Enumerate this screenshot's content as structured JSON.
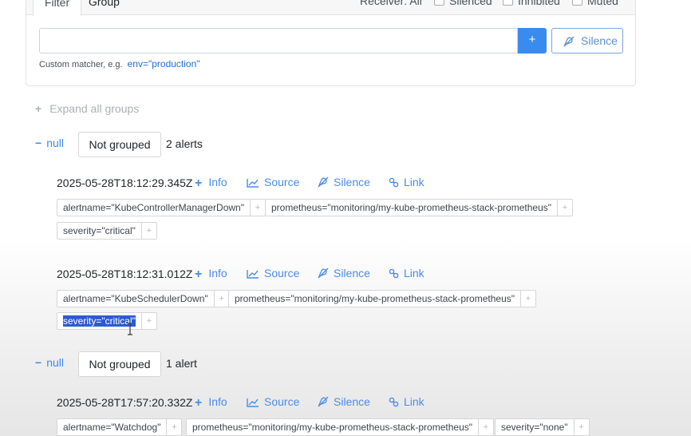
{
  "filter_card": {
    "tabs": [
      {
        "label": "Filter"
      },
      {
        "label": "Group"
      }
    ],
    "receiver_text": "Receiver: All",
    "checkboxes": [
      {
        "label": "Silenced"
      },
      {
        "label": "Inhibited"
      },
      {
        "label": "Muted"
      }
    ],
    "input_value": "",
    "plus_label": "+",
    "silence_label": "Silence",
    "hint_text": "Custom matcher, e.g.",
    "hint_example": "env=\"production\""
  },
  "expand_all": {
    "icon": "+",
    "label": "Expand all groups"
  },
  "groups": [
    {
      "collapse_icon": "−",
      "name": "null",
      "badge": "Not grouped",
      "count": "2 alerts",
      "alerts": [
        {
          "timestamp": "2025-05-28T18:12:29.345Z",
          "actions": [
            "Info",
            "Source",
            "Silence",
            "Link"
          ],
          "labels": [
            "alertname=\"KubeControllerManagerDown\"",
            "prometheus=\"monitoring/my-kube-prometheus-stack-prometheus\"",
            "severity=\"critical\""
          ]
        },
        {
          "timestamp": "2025-05-28T18:12:31.012Z",
          "actions": [
            "Info",
            "Source",
            "Silence",
            "Link"
          ],
          "labels": [
            "alertname=\"KubeSchedulerDown\"",
            "prometheus=\"monitoring/my-kube-prometheus-stack-prometheus\"",
            "severity=\"critical\""
          ]
        }
      ]
    },
    {
      "collapse_icon": "−",
      "name": "null",
      "badge": "Not grouped",
      "count": "1 alert",
      "alerts": [
        {
          "timestamp": "2025-05-28T17:57:20.332Z",
          "actions": [
            "Info",
            "Source",
            "Silence",
            "Link"
          ],
          "labels": [
            "alertname=\"Watchdog\"",
            "prometheus=\"monitoring/my-kube-prometheus-stack-prometheus\"",
            "severity=\"none\""
          ]
        }
      ]
    }
  ],
  "label_add_icon": "+",
  "colors": {
    "accent": "#3a8bee",
    "link": "#4a8ce8",
    "selection": "#2b5bd1"
  }
}
